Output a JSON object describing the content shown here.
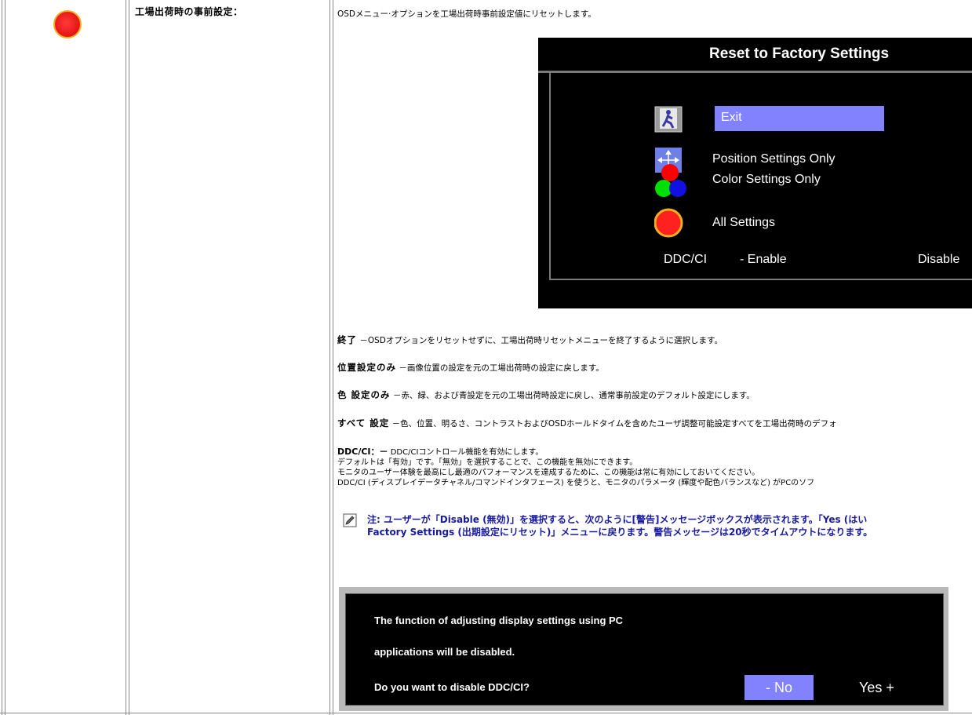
{
  "left": {
    "title": "工場出荷時の事前設定："
  },
  "intro": "OSDメニュー·オプションを工場出荷時事前設定値にリセットします。",
  "osd": {
    "title": "Reset to Factory Settings",
    "items": [
      {
        "icon": "exit-door-icon",
        "label": "Exit"
      },
      {
        "icon": "position-arrows-icon",
        "label": "Position Settings Only"
      },
      {
        "icon": "rgb-circles-icon",
        "label": "Color Settings Only"
      },
      {
        "icon": "red-circle-icon",
        "label": "All Settings"
      }
    ],
    "ddc_label": "DDC/CI",
    "ddc_enable": "- Enable",
    "ddc_disable": "Disable",
    "highlight_color": "#8282ff"
  },
  "descriptions": {
    "exit_term": "終了",
    "exit_text": "－OSDオプションをリセットせずに、工場出荷時リセットメニューを終了するように選択します。",
    "position_term": "位置設定のみ",
    "position_text": "－画像位置の設定を元の工場出荷時の設定に戻します。",
    "color_term": "色 設定のみ",
    "color_text": "－赤、緑、および青設定を元の工場出荷時設定に戻し、通常事前設定のデフォルト設定にします。",
    "all_term": "すべて 設定",
    "all_text": "－色、位置、明るさ、コントラストおよびOSDホールドタイムを含めたユーザ調整可能設定すべてを工場出荷時のデフォ",
    "ddc_term": "DDC/CI：－",
    "ddc_line1": "DDC/CIコントロール機能を有効にします。",
    "ddc_line2": "デフォルトは「有効」です。「無効」を選択することで、この機能を無効にできます。",
    "ddc_line3": "モニタのユーザー体験を最高にし最適のパフォーマンスを達成するために、この機能は常に有効にしておいてください。",
    "ddc_line4": "DDC/CI (ディスプレイデータチャネル/コマンドインタフェース) を使うと、モニタのパラメータ (輝度や配色バランスなど) がPCのソフ"
  },
  "note": {
    "line1": "注: ユーザーが「Disable (無効)」を選択すると、次のように[警告]メッセージボックスが表示されます。「Yes (はい",
    "line2": "Factory Settings (出期設定にリセット)」メニューに戻ります。警告メッセージは20秒でタイムアウトになります。"
  },
  "warning": {
    "line1": "The function of adjusting display settings using PC",
    "line2": "applications will be disabled.",
    "line3": "Do you want to disable DDC/CI?",
    "no_label": "- No",
    "yes_label": "Yes +"
  }
}
